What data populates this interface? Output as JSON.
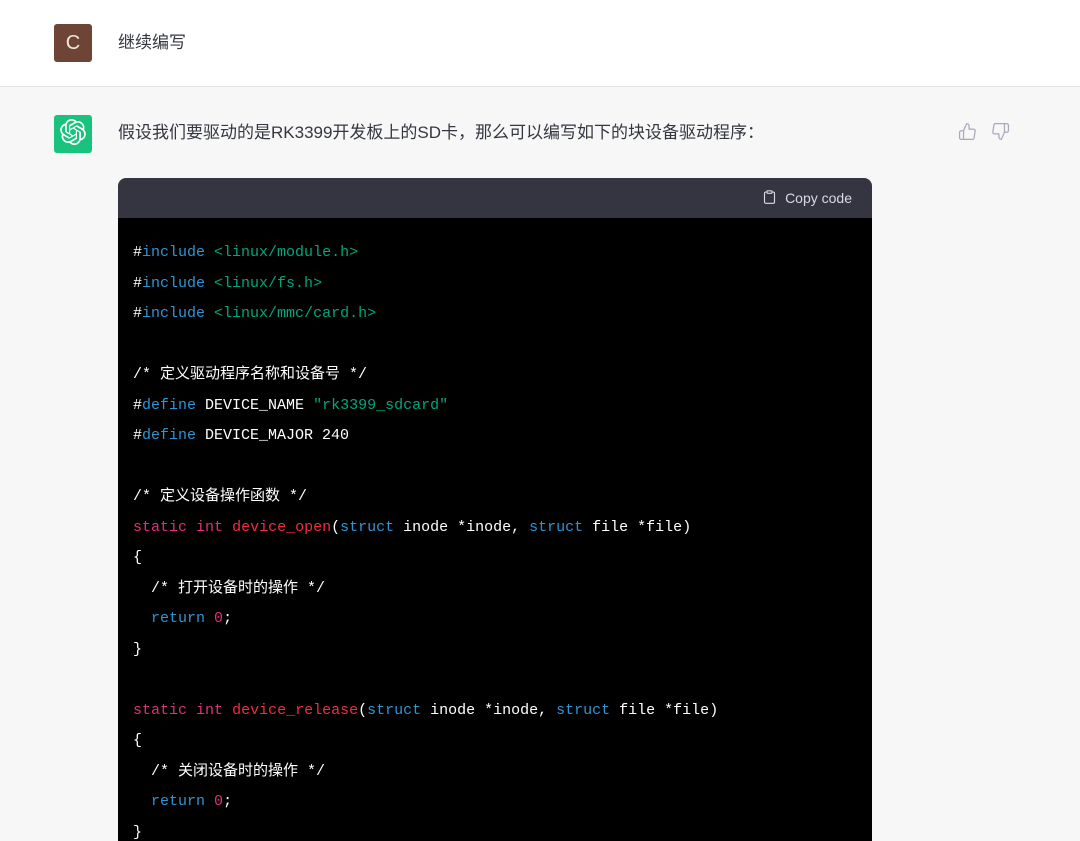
{
  "user": {
    "avatar_letter": "C",
    "avatar_color": "#6d4435",
    "message": "继续编写"
  },
  "assistant": {
    "avatar_color": "#19c37d",
    "avatar_icon": "chatgpt-logo-icon",
    "message": "假设我们要驱动的是RK3399开发板上的SD卡，那么可以编写如下的块设备驱动程序：",
    "feedback_icons": [
      "thumbs-up-icon",
      "thumbs-down-icon"
    ]
  },
  "code_block": {
    "copy_button_label": "Copy code",
    "copy_button_icon": "clipboard-icon",
    "background": "#000000",
    "header_background": "#343541",
    "colors": {
      "plain": "#ffffff",
      "keyword": "#2e95d3",
      "string": "#00a67d",
      "type": "#df3079",
      "function": "#f22c3d"
    },
    "lines": [
      [
        {
          "t": "#",
          "c": "plain"
        },
        {
          "t": "include",
          "c": "keyword"
        },
        {
          "t": " ",
          "c": "plain"
        },
        {
          "t": "<linux/module.h>",
          "c": "string"
        }
      ],
      [
        {
          "t": "#",
          "c": "plain"
        },
        {
          "t": "include",
          "c": "keyword"
        },
        {
          "t": " ",
          "c": "plain"
        },
        {
          "t": "<linux/fs.h>",
          "c": "string"
        }
      ],
      [
        {
          "t": "#",
          "c": "plain"
        },
        {
          "t": "include",
          "c": "keyword"
        },
        {
          "t": " ",
          "c": "plain"
        },
        {
          "t": "<linux/mmc/card.h>",
          "c": "string"
        }
      ],
      [],
      [
        {
          "t": "/* 定义驱动程序名称和设备号 */",
          "c": "plain"
        }
      ],
      [
        {
          "t": "#",
          "c": "plain"
        },
        {
          "t": "define",
          "c": "keyword"
        },
        {
          "t": " DEVICE_NAME ",
          "c": "plain"
        },
        {
          "t": "\"rk3399_sdcard\"",
          "c": "string"
        }
      ],
      [
        {
          "t": "#",
          "c": "plain"
        },
        {
          "t": "define",
          "c": "keyword"
        },
        {
          "t": " DEVICE_MAJOR 240",
          "c": "plain"
        }
      ],
      [],
      [
        {
          "t": "/* 定义设备操作函数 */",
          "c": "plain"
        }
      ],
      [
        {
          "t": "static",
          "c": "type"
        },
        {
          "t": " ",
          "c": "plain"
        },
        {
          "t": "int",
          "c": "type"
        },
        {
          "t": " ",
          "c": "plain"
        },
        {
          "t": "device_open",
          "c": "function"
        },
        {
          "t": "(",
          "c": "plain"
        },
        {
          "t": "struct",
          "c": "keyword"
        },
        {
          "t": " inode *inode, ",
          "c": "plain"
        },
        {
          "t": "struct",
          "c": "keyword"
        },
        {
          "t": " file *file)",
          "c": "plain"
        }
      ],
      [
        {
          "t": "{",
          "c": "plain"
        }
      ],
      [
        {
          "t": "  /* 打开设备时的操作 */",
          "c": "plain"
        }
      ],
      [
        {
          "t": "  ",
          "c": "plain"
        },
        {
          "t": "return",
          "c": "keyword"
        },
        {
          "t": " ",
          "c": "plain"
        },
        {
          "t": "0",
          "c": "type"
        },
        {
          "t": ";",
          "c": "plain"
        }
      ],
      [
        {
          "t": "}",
          "c": "plain"
        }
      ],
      [],
      [
        {
          "t": "static",
          "c": "type"
        },
        {
          "t": " ",
          "c": "plain"
        },
        {
          "t": "int",
          "c": "type"
        },
        {
          "t": " ",
          "c": "plain"
        },
        {
          "t": "device_release",
          "c": "function"
        },
        {
          "t": "(",
          "c": "plain"
        },
        {
          "t": "struct",
          "c": "keyword"
        },
        {
          "t": " inode *inode, ",
          "c": "plain"
        },
        {
          "t": "struct",
          "c": "keyword"
        },
        {
          "t": " file *file)",
          "c": "plain"
        }
      ],
      [
        {
          "t": "{",
          "c": "plain"
        }
      ],
      [
        {
          "t": "  /* 关闭设备时的操作 */",
          "c": "plain"
        }
      ],
      [
        {
          "t": "  ",
          "c": "plain"
        },
        {
          "t": "return",
          "c": "keyword"
        },
        {
          "t": " ",
          "c": "plain"
        },
        {
          "t": "0",
          "c": "type"
        },
        {
          "t": ";",
          "c": "plain"
        }
      ],
      [
        {
          "t": "}",
          "c": "plain"
        }
      ]
    ]
  }
}
